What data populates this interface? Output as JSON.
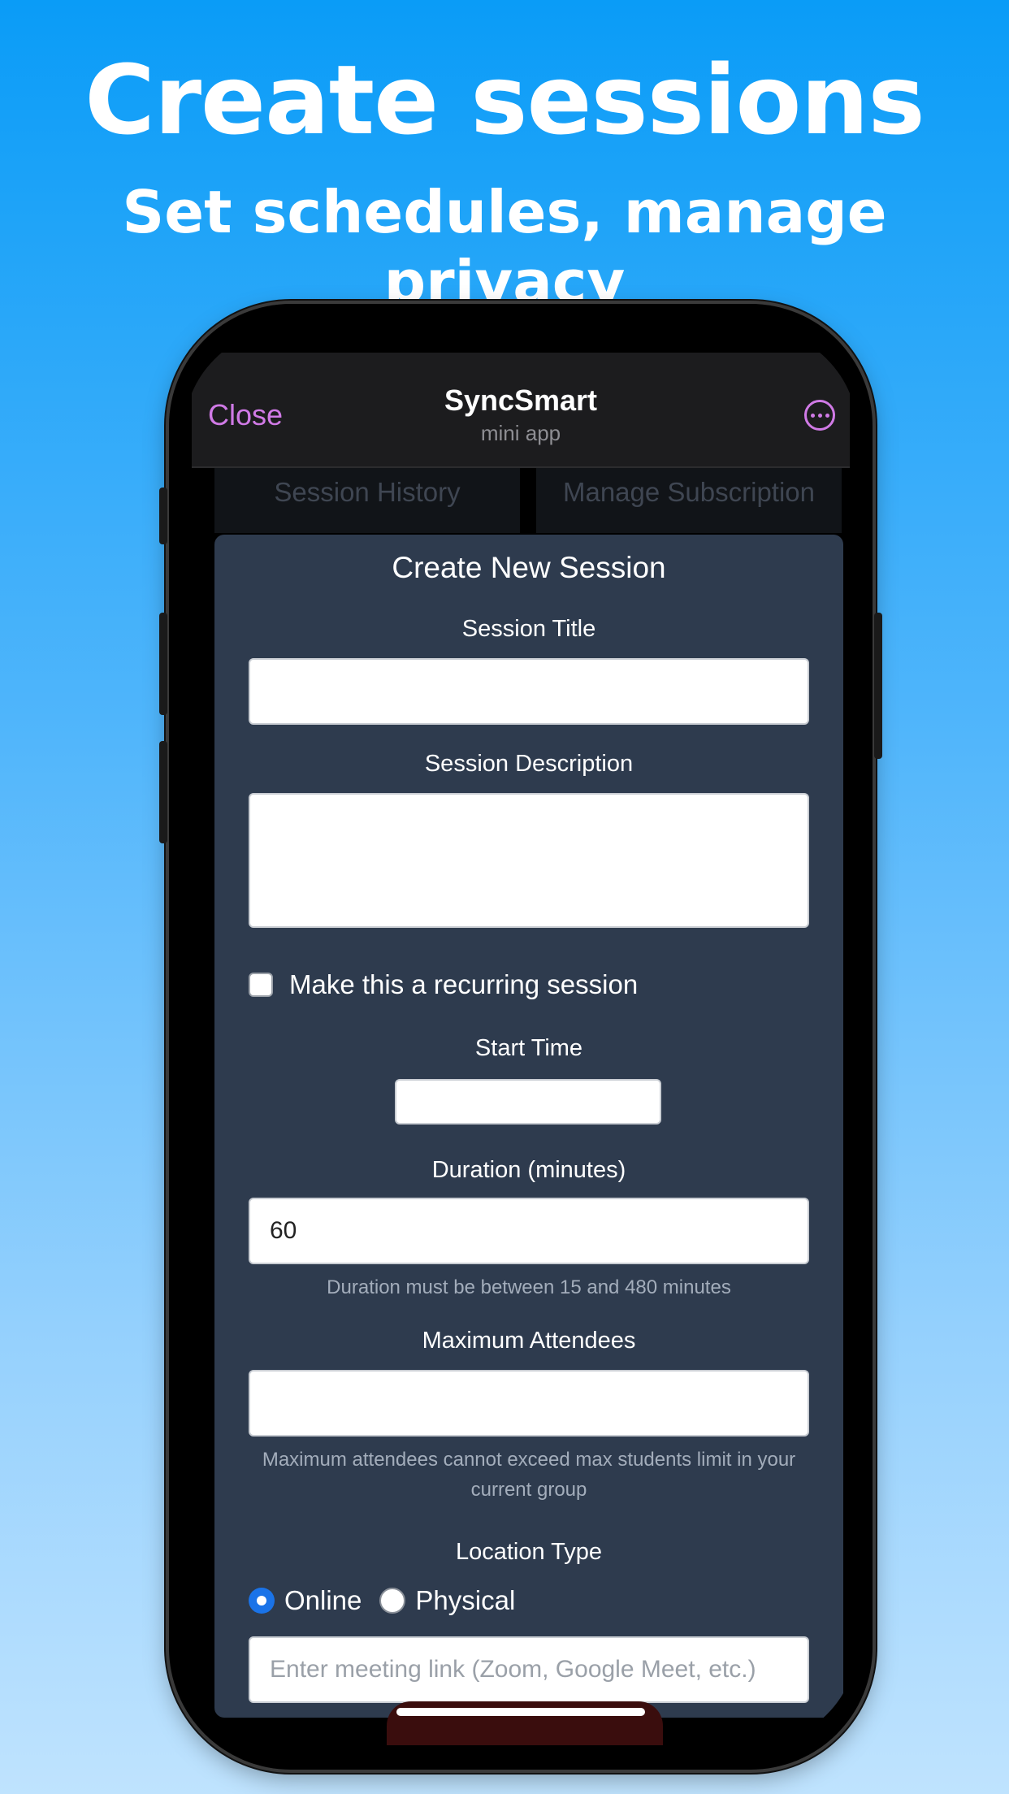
{
  "promo": {
    "headline": "Create sessions",
    "subheadline": "Set schedules, manage privacy"
  },
  "navbar": {
    "close_label": "Close",
    "app_title": "SyncSmart",
    "app_subtitle": "mini app",
    "more_icon": "more-horizontal-circle-icon"
  },
  "tabs": [
    {
      "label": "Session History"
    },
    {
      "label": "Manage Subscription"
    }
  ],
  "form": {
    "heading": "Create New Session",
    "session_title": {
      "label": "Session Title",
      "value": ""
    },
    "session_description": {
      "label": "Session Description",
      "value": ""
    },
    "recurring": {
      "label": "Make this a recurring session",
      "checked": false
    },
    "start_time": {
      "label": "Start Time",
      "value": ""
    },
    "duration": {
      "label": "Duration (minutes)",
      "value": "60",
      "hint": "Duration must be between 15 and 480 minutes"
    },
    "max_attendees": {
      "label": "Maximum Attendees",
      "value": "",
      "hint": "Maximum attendees cannot exceed max students limit in your current group"
    },
    "location_type": {
      "label": "Location Type",
      "options": [
        {
          "label": "Online",
          "selected": true
        },
        {
          "label": "Physical",
          "selected": false
        }
      ]
    },
    "meeting_link": {
      "value": "",
      "placeholder": "Enter meeting link (Zoom, Google Meet, etc.)"
    }
  },
  "colors": {
    "accent": "#d07ae6",
    "card_bg": "#2e3b4e",
    "radio_selected": "#1a73e8"
  }
}
